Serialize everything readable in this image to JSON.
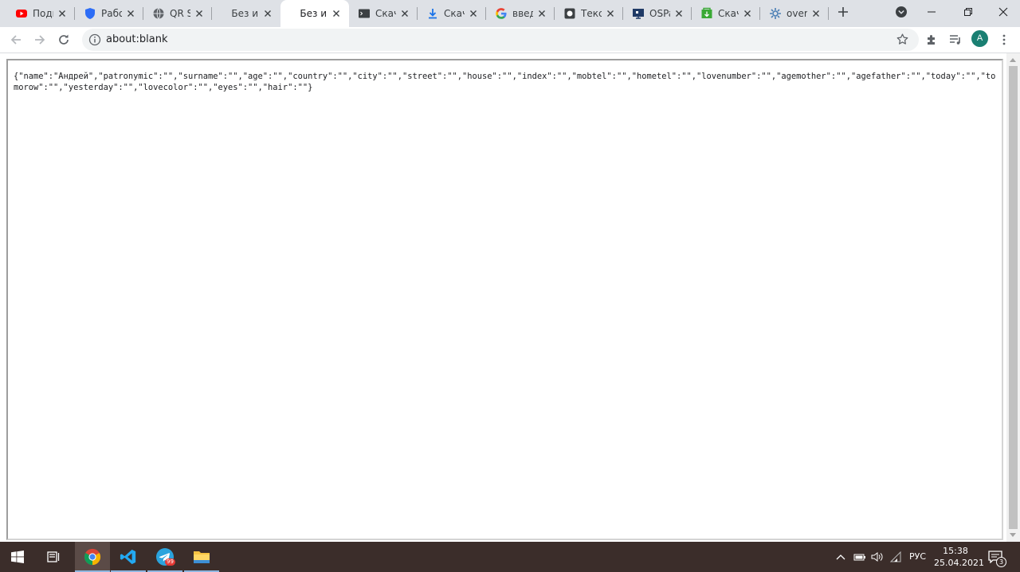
{
  "browser": {
    "tabs": [
      {
        "title": "Подк",
        "icon": "youtube-icon"
      },
      {
        "title": "Рабо",
        "icon": "shield-icon"
      },
      {
        "title": "QR S",
        "icon": "globe-icon"
      },
      {
        "title": "Без и",
        "icon": ""
      },
      {
        "title": "Без и",
        "icon": "",
        "active": true
      },
      {
        "title": "Скач",
        "icon": "terminal-icon"
      },
      {
        "title": "Скач",
        "icon": "download-icon"
      },
      {
        "title": "введ",
        "icon": "google-icon"
      },
      {
        "title": "Текст",
        "icon": "square-app-icon"
      },
      {
        "title": "OSPa",
        "icon": "monitor-icon"
      },
      {
        "title": "Скач",
        "icon": "green-app-icon"
      },
      {
        "title": "overf",
        "icon": "gear-icon"
      }
    ],
    "url": "about:blank",
    "avatar_letter": "A"
  },
  "content": {
    "text": "{\"name\":\"Андрей\",\"patronymic\":\"\",\"surname\":\"\",\"age\":\"\",\"country\":\"\",\"city\":\"\",\"street\":\"\",\"house\":\"\",\"index\":\"\",\"mobtel\":\"\",\"hometel\":\"\",\"lovenumber\":\"\",\"agemother\":\"\",\"agefather\":\"\",\"today\":\"\",\"tomorow\":\"\",\"yesterday\":\"\",\"lovecolor\":\"\",\"eyes\":\"\",\"hair\":\"\"}"
  },
  "taskbar": {
    "language": "РУС",
    "time": "15:38",
    "date": "25.04.2021",
    "notification_count": "3",
    "telegram_badge": "99"
  },
  "colors": {
    "tabstrip": "#dee1e6",
    "omnibox": "#f1f3f4",
    "taskbar": "#3b2d2a",
    "avatar": "#1a7f72"
  }
}
